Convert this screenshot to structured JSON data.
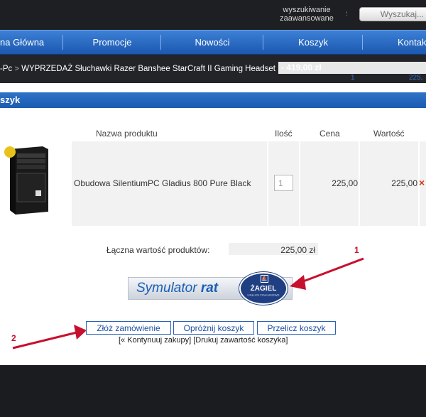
{
  "header": {
    "advanced_search_line1": "wyszukiwanie",
    "advanced_search_line2": "zaawansowane",
    "search_placeholder": "Wyszukaj..."
  },
  "nav": {
    "items": [
      "na Główna",
      "Promocje",
      "Nowości",
      "Koszyk",
      "Kontakt"
    ]
  },
  "breadcrumb": {
    "prefix": "-Pc",
    "separator": ">",
    "text": "WYPRZEDAŻ Słuchawki Razer Banshee StarCraft II Gaming Headset",
    "price": "- 419,00 zł"
  },
  "mini_cart": {
    "count": "1",
    "value": "225,"
  },
  "cart": {
    "title": "szyk",
    "columns": {
      "name": "Nazwa produktu",
      "qty": "Ilość",
      "price": "Cena",
      "value": "Wartość"
    },
    "items": [
      {
        "name": "Obudowa SilentiumPC Gladius 800 Pure Black",
        "qty": "1",
        "price": "225,00",
        "value": "225,00",
        "remove": "×"
      }
    ],
    "total_label": "Łączna wartość produktów:",
    "total_value": "225,00 zł"
  },
  "simulator": {
    "label": "Symulator",
    "label_bold": "rat",
    "brand": "ŻAGIEL",
    "brand_sub": "USŁUGI FINANSOWE"
  },
  "actions": {
    "order": "Złóż zamówienie",
    "empty": "Opróżnij koszyk",
    "recalc": "Przelicz koszyk",
    "continue": "[« Kontynuuj zakupy]",
    "print": "[Drukuj zawartość koszyka]"
  },
  "annotations": {
    "marker1": "1",
    "marker2": "2"
  },
  "colors": {
    "nav": "#2a6ac8",
    "arrow": "#c8102e",
    "button_border": "#2b60b6"
  }
}
